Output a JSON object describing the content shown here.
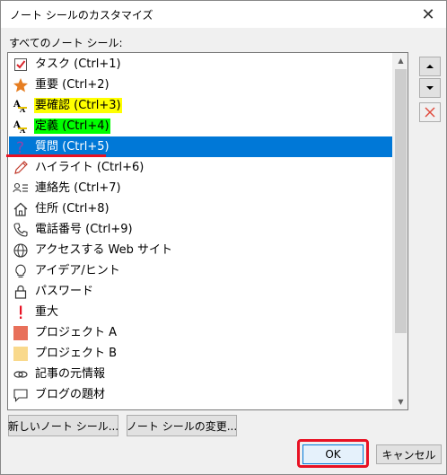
{
  "window": {
    "title": "ノート シールのカスタマイズ",
    "close_glyph": "✕"
  },
  "list_label": "すべてのノート シール:",
  "tags": [
    {
      "label": "タスク (Ctrl+1)",
      "icon": "checkbox-icon"
    },
    {
      "label": "重要 (Ctrl+2)",
      "icon": "star-icon"
    },
    {
      "label": "要確認 (Ctrl+3)",
      "icon": "highlighter-a-icon",
      "highlight": "yellow"
    },
    {
      "label": "定義 (Ctrl+4)",
      "icon": "highlighter-a-icon",
      "highlight": "green"
    },
    {
      "label": "質問 (Ctrl+5)",
      "icon": "question-icon",
      "selected": true
    },
    {
      "label": "ハイライト (Ctrl+6)",
      "icon": "pencil-icon"
    },
    {
      "label": "連絡先 (Ctrl+7)",
      "icon": "contact-icon"
    },
    {
      "label": "住所 (Ctrl+8)",
      "icon": "house-icon"
    },
    {
      "label": "電話番号 (Ctrl+9)",
      "icon": "phone-icon"
    },
    {
      "label": "アクセスする Web サイト",
      "icon": "globe-icon"
    },
    {
      "label": "アイデア/ヒント",
      "icon": "lightbulb-icon"
    },
    {
      "label": "パスワード",
      "icon": "lock-icon"
    },
    {
      "label": "重大",
      "icon": "exclamation-icon"
    },
    {
      "label": "プロジェクト A",
      "icon": "color-square-icon",
      "color": "#e8705a"
    },
    {
      "label": "プロジェクト B",
      "icon": "color-square-icon",
      "color": "#f9d98c"
    },
    {
      "label": "記事の元情報",
      "icon": "link-icon"
    },
    {
      "label": "ブログの題材",
      "icon": "speech-bubble-icon"
    }
  ],
  "buttons": {
    "new_tag": "新しいノート シール...",
    "modify_tag": "ノート シールの変更...",
    "ok": "OK",
    "cancel": "キャンセル"
  },
  "colors": {
    "selection": "#0078d7",
    "annotation_red": "#e81123",
    "highlight_yellow": "#ffff00",
    "highlight_green": "#00ff00",
    "check_red": "#d9262c",
    "star_orange": "#e67e22",
    "question_purple": "#8e44ad"
  }
}
